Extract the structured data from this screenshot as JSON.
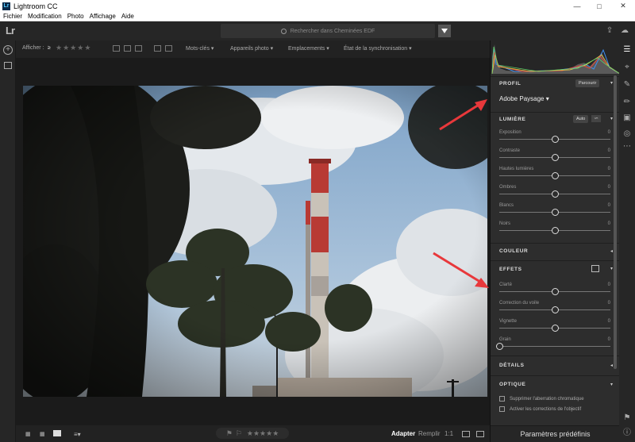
{
  "window": {
    "title": "Lightroom CC",
    "icon": "Lr"
  },
  "menu": [
    "Fichier",
    "Modification",
    "Photo",
    "Affichage",
    "Aide"
  ],
  "header": {
    "logo": "Lr",
    "search_placeholder": "Rechercher dans Cheminées EDF"
  },
  "filterbar": {
    "show_label": "Afficher :",
    "rating_count": "≥",
    "keywords": "Mots-clés",
    "cameras": "Appareils photo",
    "locations": "Emplacements",
    "sync_state": "État de la synchronisation"
  },
  "bottombar": {
    "fit": "Adapter",
    "fill": "Remplir",
    "one_to_one": "1:1"
  },
  "panel": {
    "profile": {
      "title": "PROFIL",
      "browse": "Parcourir",
      "value": "Adobe Paysage"
    },
    "light": {
      "title": "LUMIÈRE",
      "auto": "Auto",
      "sliders": [
        {
          "label": "Exposition",
          "value": "0",
          "pos": 0.5
        },
        {
          "label": "Contraste",
          "value": "0",
          "pos": 0.5
        },
        {
          "label": "Hautes lumières",
          "value": "0",
          "pos": 0.5
        },
        {
          "label": "Ombres",
          "value": "0",
          "pos": 0.5
        },
        {
          "label": "Blancs",
          "value": "0",
          "pos": 0.5
        },
        {
          "label": "Noirs",
          "value": "0",
          "pos": 0.5
        }
      ]
    },
    "color": {
      "title": "COULEUR"
    },
    "effects": {
      "title": "EFFETS",
      "sliders": [
        {
          "label": "Clarté",
          "value": "0",
          "pos": 0.5
        },
        {
          "label": "Correction du voile",
          "value": "0",
          "pos": 0.5
        },
        {
          "label": "Vignette",
          "value": "0",
          "pos": 0.5
        },
        {
          "label": "Grain",
          "value": "0",
          "pos": 0.0
        }
      ]
    },
    "details": {
      "title": "DÉTAILS"
    },
    "optics": {
      "title": "OPTIQUE",
      "options": [
        "Supprimer l'aberration chromatique",
        "Activer les corrections de l'objectif"
      ]
    },
    "presets": "Paramètres prédéfinis"
  },
  "colors": {
    "accent_arrow": "#e8383b",
    "panel_bg": "#2d2d2d"
  }
}
